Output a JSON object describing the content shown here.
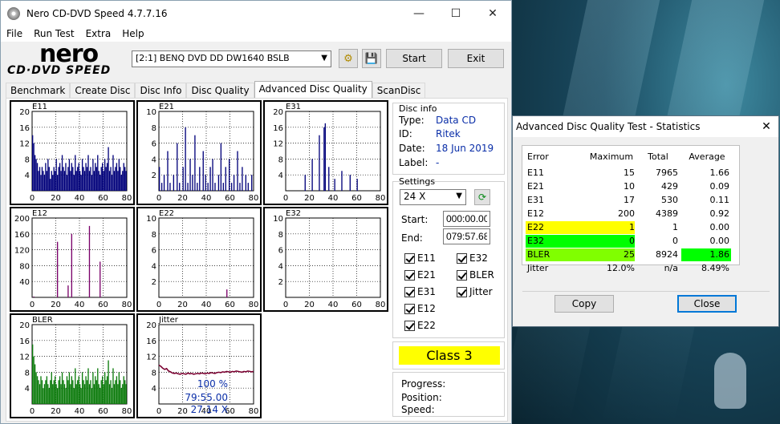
{
  "window": {
    "title": "Nero CD-DVD Speed 4.7.7.16",
    "minimize": "—",
    "maximize": "☐",
    "close": "✕"
  },
  "menu": [
    "File",
    "Run Test",
    "Extra",
    "Help"
  ],
  "logo": {
    "top": "nero",
    "bottom": "CD·DVD SPEED"
  },
  "toolbar": {
    "drive": "[2:1]   BENQ DVD DD DW1640 BSLB",
    "start": "Start",
    "exit": "Exit"
  },
  "tabs": [
    "Benchmark",
    "Create Disc",
    "Disc Info",
    "Disc Quality",
    "Advanced Disc Quality",
    "ScanDisc"
  ],
  "active_tab": "Advanced Disc Quality",
  "disc_info": {
    "heading": "Disc info",
    "type_label": "Type:",
    "type": "Data CD",
    "id_label": "ID:",
    "id": "Ritek",
    "date_label": "Date:",
    "date": "18 Jun 2019",
    "label_label": "Label:",
    "label": "-"
  },
  "settings": {
    "heading": "Settings",
    "speed": "24 X",
    "start_label": "Start:",
    "start": "000:00.00",
    "end_label": "End:",
    "end": "079:57.68",
    "checkboxes": [
      "E11",
      "E32",
      "E21",
      "BLER",
      "E31",
      "Jitter",
      "E12",
      "E22"
    ]
  },
  "quality_class": "Class 3",
  "progress": {
    "progress_label": "Progress:",
    "progress": "100 %",
    "position_label": "Position:",
    "position": "79:55.00",
    "speed_label": "Speed:",
    "speed": "27.14 X"
  },
  "colors": {
    "navy": "#00007a",
    "purple": "#7a006a",
    "green": "#0a7a0a",
    "jitter": "#7a0030",
    "highlight_yellow": "#ffff00",
    "highlight_green": "#00ff00",
    "highlight_lime": "#80ff00"
  },
  "chart_data": [
    {
      "type": "bar",
      "title": "E11",
      "ylim": [
        0,
        20
      ],
      "yticks": [
        4,
        8,
        12,
        16,
        20
      ],
      "xticks": [
        0,
        20,
        40,
        60,
        80
      ],
      "series_color": "#00007a",
      "values": [
        14,
        12,
        9,
        8,
        7,
        5,
        6,
        4,
        6,
        5,
        4,
        7,
        5,
        8,
        6,
        3,
        5,
        4,
        6,
        5,
        8,
        4,
        6,
        7,
        5,
        9,
        6,
        5,
        7,
        4,
        6,
        8,
        5,
        7,
        6,
        4,
        9,
        5,
        6,
        7,
        5,
        4,
        8,
        6,
        5,
        7,
        6,
        9,
        5,
        6,
        4,
        8,
        5,
        7,
        6,
        9,
        5,
        4,
        6,
        7,
        5,
        8,
        6,
        7,
        11,
        5,
        6,
        4,
        9,
        5,
        6,
        7,
        5,
        8,
        6,
        4,
        5,
        7,
        6,
        5
      ]
    },
    {
      "type": "bar",
      "title": "E21",
      "ylim": [
        0,
        10
      ],
      "yticks": [
        2,
        4,
        6,
        8,
        10
      ],
      "xticks": [
        0,
        20,
        40,
        60,
        80
      ],
      "series_color": "#00007a",
      "values": [
        3,
        0,
        1,
        0,
        2,
        0,
        0,
        5,
        0,
        1,
        0,
        0,
        2,
        0,
        0,
        6,
        0,
        1,
        0,
        0,
        3,
        0,
        8,
        0,
        1,
        0,
        4,
        0,
        2,
        0,
        7,
        0,
        1,
        0,
        3,
        0,
        0,
        5,
        0,
        2,
        0,
        1,
        0,
        3,
        0,
        4,
        0,
        1,
        0,
        0,
        2,
        0,
        6,
        0,
        1,
        0,
        3,
        0,
        0,
        4,
        0,
        1,
        0,
        2,
        0,
        0,
        5,
        0,
        1,
        0,
        3,
        0,
        0,
        2,
        0,
        1,
        0,
        0,
        2,
        0
      ]
    },
    {
      "type": "bar",
      "title": "E31",
      "ylim": [
        0,
        20
      ],
      "yticks": [
        4,
        8,
        12,
        16,
        20
      ],
      "xticks": [
        0,
        20,
        40,
        60,
        80
      ],
      "series_color": "#00007a",
      "values": [
        0,
        0,
        0,
        0,
        0,
        0,
        0,
        0,
        0,
        0,
        0,
        0,
        0,
        0,
        0,
        0,
        4,
        0,
        0,
        0,
        0,
        0,
        8,
        0,
        0,
        0,
        0,
        0,
        14,
        0,
        0,
        0,
        16,
        17,
        0,
        0,
        6,
        0,
        0,
        0,
        0,
        3,
        0,
        0,
        0,
        0,
        0,
        5,
        0,
        0,
        0,
        0,
        0,
        0,
        4,
        0,
        0,
        0,
        0,
        0,
        3,
        0,
        0,
        0,
        0,
        0,
        0,
        0,
        0,
        0,
        0,
        0,
        0,
        0,
        0,
        0,
        0,
        0,
        0,
        0
      ]
    },
    {
      "type": "bar",
      "title": "E12",
      "ylim": [
        0,
        200
      ],
      "yticks": [
        40,
        80,
        120,
        160,
        200
      ],
      "xticks": [
        0,
        20,
        40,
        60,
        80
      ],
      "series_color": "#7a006a",
      "values": [
        0,
        2,
        0,
        0,
        0,
        0,
        0,
        0,
        0,
        0,
        0,
        0,
        0,
        0,
        0,
        0,
        0,
        0,
        0,
        0,
        0,
        140,
        0,
        0,
        0,
        0,
        0,
        0,
        0,
        0,
        30,
        0,
        0,
        160,
        0,
        0,
        0,
        0,
        0,
        0,
        0,
        0,
        0,
        0,
        0,
        0,
        0,
        0,
        180,
        0,
        0,
        0,
        0,
        0,
        0,
        0,
        0,
        90,
        0,
        0,
        0,
        0,
        0,
        0,
        0,
        0,
        0,
        0,
        0,
        0,
        0,
        0,
        0,
        0,
        0,
        0,
        0,
        0,
        0,
        0
      ]
    },
    {
      "type": "bar",
      "title": "E22",
      "ylim": [
        0,
        10
      ],
      "yticks": [
        2,
        4,
        6,
        8,
        10
      ],
      "xticks": [
        0,
        20,
        40,
        60,
        80
      ],
      "series_color": "#7a006a",
      "values": [
        0,
        0,
        0,
        0,
        0,
        0,
        0,
        0,
        0,
        0,
        0,
        0,
        0,
        0,
        0,
        0,
        0,
        0,
        0,
        0,
        0,
        0,
        0,
        0,
        0,
        0,
        0,
        0,
        0,
        0,
        0,
        0,
        0,
        0,
        0,
        0,
        0,
        0,
        0,
        0,
        0,
        0,
        0,
        0,
        0,
        0,
        0,
        0,
        0,
        0,
        0,
        0,
        0,
        0,
        0,
        0,
        0,
        1,
        0,
        0,
        0,
        0,
        0,
        0,
        0,
        0,
        0,
        0,
        0,
        0,
        0,
        0,
        0,
        0,
        0,
        0,
        0,
        0,
        0,
        0
      ]
    },
    {
      "type": "bar",
      "title": "E32",
      "ylim": [
        0,
        10
      ],
      "yticks": [
        2,
        4,
        6,
        8,
        10
      ],
      "xticks": [
        0,
        20,
        40,
        60,
        80
      ],
      "series_color": "#7a006a",
      "values": []
    },
    {
      "type": "bar",
      "title": "BLER",
      "ylim": [
        0,
        20
      ],
      "yticks": [
        4,
        8,
        12,
        16,
        20
      ],
      "xticks": [
        0,
        20,
        40,
        60,
        80
      ],
      "series_color": "#0a7a0a",
      "values": [
        15,
        12,
        10,
        8,
        7,
        6,
        5,
        7,
        6,
        4,
        5,
        6,
        7,
        5,
        4,
        6,
        8,
        5,
        6,
        7,
        5,
        4,
        6,
        7,
        5,
        8,
        6,
        5,
        4,
        7,
        6,
        8,
        5,
        7,
        6,
        4,
        9,
        5,
        6,
        7,
        5,
        4,
        8,
        6,
        5,
        7,
        6,
        9,
        5,
        6,
        4,
        8,
        5,
        7,
        6,
        9,
        5,
        4,
        6,
        7,
        5,
        8,
        6,
        7,
        11,
        5,
        6,
        4,
        9,
        5,
        6,
        7,
        5,
        8,
        6,
        4,
        5,
        7,
        6,
        5
      ]
    },
    {
      "type": "line",
      "title": "Jitter",
      "ylim": [
        0,
        20
      ],
      "yticks": [
        4,
        8,
        12,
        16,
        20
      ],
      "xticks": [
        0,
        20,
        40,
        60,
        80
      ],
      "series_color": "#7a0030",
      "values": [
        9.8,
        9.5,
        9.0,
        8.7,
        8.9,
        8.3,
        8.1,
        7.8,
        7.7,
        7.8,
        7.6,
        7.5,
        7.7,
        7.6,
        7.5,
        7.8,
        7.6,
        7.7,
        7.5,
        7.6,
        7.7,
        7.6,
        7.8,
        7.7,
        7.6,
        7.8,
        7.7,
        7.9,
        7.8,
        7.7,
        7.9,
        8.0,
        7.9,
        8.1,
        8.0,
        8.2,
        8.1,
        8.0,
        8.2,
        8.1,
        8.3,
        8.2,
        8.1,
        8.0,
        8.2,
        8.1,
        8.3,
        8.2,
        8.1,
        8.2
      ]
    }
  ],
  "stats": {
    "title": "Advanced Disc Quality Test - Statistics",
    "headers": [
      "Error",
      "Maximum",
      "Total",
      "Average"
    ],
    "rows": [
      {
        "name": "E11",
        "max": "15",
        "total": "7965",
        "avg": "1.66",
        "name_hl": "",
        "avg_hl": ""
      },
      {
        "name": "E21",
        "max": "10",
        "total": "429",
        "avg": "0.09",
        "name_hl": "",
        "avg_hl": ""
      },
      {
        "name": "E31",
        "max": "17",
        "total": "530",
        "avg": "0.11",
        "name_hl": "",
        "avg_hl": ""
      },
      {
        "name": "E12",
        "max": "200",
        "total": "4389",
        "avg": "0.92",
        "name_hl": "",
        "avg_hl": ""
      },
      {
        "name": "E22",
        "max": "1",
        "total": "1",
        "avg": "0.00",
        "name_hl": "#ffff00",
        "avg_hl": ""
      },
      {
        "name": "E32",
        "max": "0",
        "total": "0",
        "avg": "0.00",
        "name_hl": "#00ff00",
        "avg_hl": ""
      },
      {
        "name": "BLER",
        "max": "25",
        "total": "8924",
        "avg": "1.86",
        "name_hl": "#80ff00",
        "avg_hl": "#00ff00"
      },
      {
        "name": "Jitter",
        "max": "12.0%",
        "total": "n/a",
        "avg": "8.49%",
        "name_hl": "",
        "avg_hl": ""
      }
    ],
    "copy": "Copy",
    "close": "Close",
    "close_icon": "✕"
  }
}
